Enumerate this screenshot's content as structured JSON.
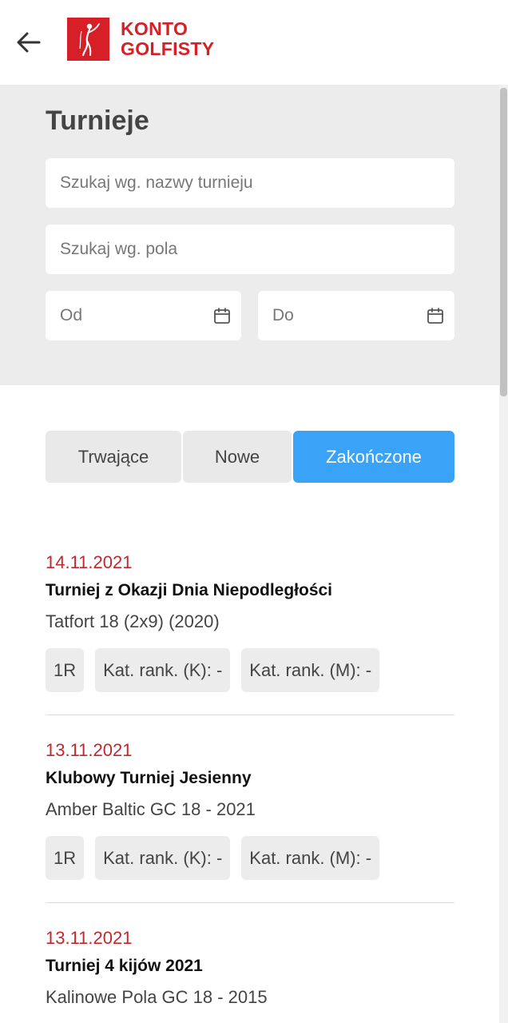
{
  "header": {
    "logo_line1": "KONTO",
    "logo_line2": "GOLFISTY",
    "brand_color": "#d61f26"
  },
  "filters": {
    "title": "Turnieje",
    "name_search_placeholder": "Szukaj wg. nazwy turnieju",
    "course_search_placeholder": "Szukaj wg. pola",
    "date_from_placeholder": "Od",
    "date_to_placeholder": "Do"
  },
  "tabs": [
    {
      "label": "Trwające",
      "active": false
    },
    {
      "label": "Nowe",
      "active": false
    },
    {
      "label": "Zakończone",
      "active": true
    }
  ],
  "accent_color": "#3aa3f7",
  "tournaments": [
    {
      "date": "14.11.2021",
      "name": "Turniej z Okazji Dnia Niepodległości",
      "course": "Tatfort 18 (2x9) (2020)",
      "badges": [
        "1R",
        "Kat. rank. (K): -",
        "Kat. rank. (M): -"
      ]
    },
    {
      "date": "13.11.2021",
      "name": "Klubowy Turniej Jesienny",
      "course": "Amber Baltic GC 18 - 2021",
      "badges": [
        "1R",
        "Kat. rank. (K): -",
        "Kat. rank. (M): -"
      ]
    },
    {
      "date": "13.11.2021",
      "name": "Turniej 4 kijów 2021",
      "course": "Kalinowe Pola GC 18 - 2015",
      "badges": []
    }
  ]
}
